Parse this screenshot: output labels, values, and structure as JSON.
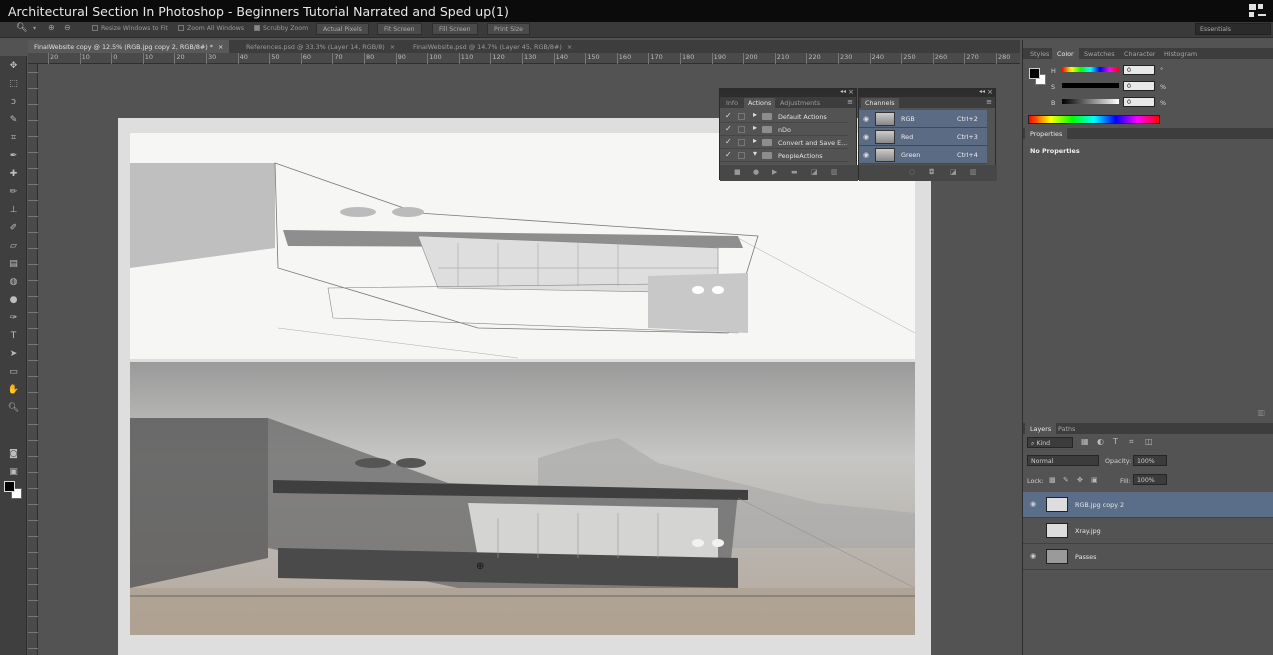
{
  "window": {
    "title": "Architectural Section In Photoshop - Beginners Tutorial Narrated and Sped up(1)"
  },
  "options_bar": {
    "resize_windows": "Resize Windows to Fit",
    "zoom_all": "Zoom All Windows",
    "scrubby": "Scrubby Zoom",
    "actual_pixels": "Actual Pixels",
    "fit_screen": "Fit Screen",
    "fill_screen": "Fill Screen",
    "print_size": "Print Size",
    "workspace": "Essentials"
  },
  "doc_tabs": [
    {
      "label": "FinalWebsite copy @ 12.5% (RGB.jpg copy 2, RGB/8#) *",
      "active": true
    },
    {
      "label": "References.psd @ 33.3% (Layer 14, RGB/8)",
      "active": false
    },
    {
      "label": "FinalWebsite.psd @ 14.7% (Layer 45, RGB/8#)",
      "active": false
    }
  ],
  "ruler_labels": [
    "20",
    "10",
    "0",
    "10",
    "20",
    "30",
    "40",
    "50",
    "60",
    "70",
    "80",
    "90",
    "100",
    "110",
    "120",
    "130",
    "140",
    "150",
    "160",
    "170",
    "180",
    "190",
    "200",
    "210",
    "220",
    "230",
    "240",
    "250",
    "260",
    "270",
    "280"
  ],
  "actions_panel": {
    "tabs": [
      "Info",
      "Actions",
      "Adjustments"
    ],
    "active_tab": "Actions",
    "items": [
      {
        "name": "Default Actions",
        "checked": true,
        "expanded": false
      },
      {
        "name": "nDo",
        "checked": true,
        "expanded": false
      },
      {
        "name": "Convert and Save E...",
        "checked": true,
        "expanded": false
      },
      {
        "name": "PeopleActions",
        "checked": true,
        "expanded": true
      }
    ]
  },
  "channels_panel": {
    "tab": "Channels",
    "items": [
      {
        "name": "RGB",
        "shortcut": "Ctrl+2"
      },
      {
        "name": "Red",
        "shortcut": "Ctrl+3"
      },
      {
        "name": "Green",
        "shortcut": "Ctrl+4"
      }
    ]
  },
  "color_panel": {
    "tabs": [
      "Styles",
      "Color",
      "Swatches",
      "Character",
      "Histogram"
    ],
    "active_tab": "Color",
    "h_label": "H",
    "h_value": "0",
    "h_unit": "°",
    "s_label": "S",
    "s_value": "0",
    "s_unit": "%",
    "b_label": "B",
    "b_value": "0",
    "b_unit": "%"
  },
  "properties_panel": {
    "tab": "Properties",
    "text": "No Properties"
  },
  "layers_panel": {
    "tabs": [
      "Layers",
      "Paths"
    ],
    "active_tab": "Layers",
    "kind": "Kind",
    "blend_mode": "Normal",
    "opacity_label": "Opacity:",
    "opacity_value": "100%",
    "lock_label": "Lock:",
    "fill_label": "Fill:",
    "fill_value": "100%",
    "layers": [
      {
        "name": "RGB.jpg copy 2",
        "selected": true,
        "visible": true
      },
      {
        "name": "Xray.jpg",
        "selected": false,
        "visible": false
      },
      {
        "name": "Passes",
        "selected": false,
        "visible": true
      }
    ]
  },
  "colors": {
    "selection": "#5a6e8a",
    "panel_bg": "#535353",
    "titlebar": "#0b0b0b"
  }
}
